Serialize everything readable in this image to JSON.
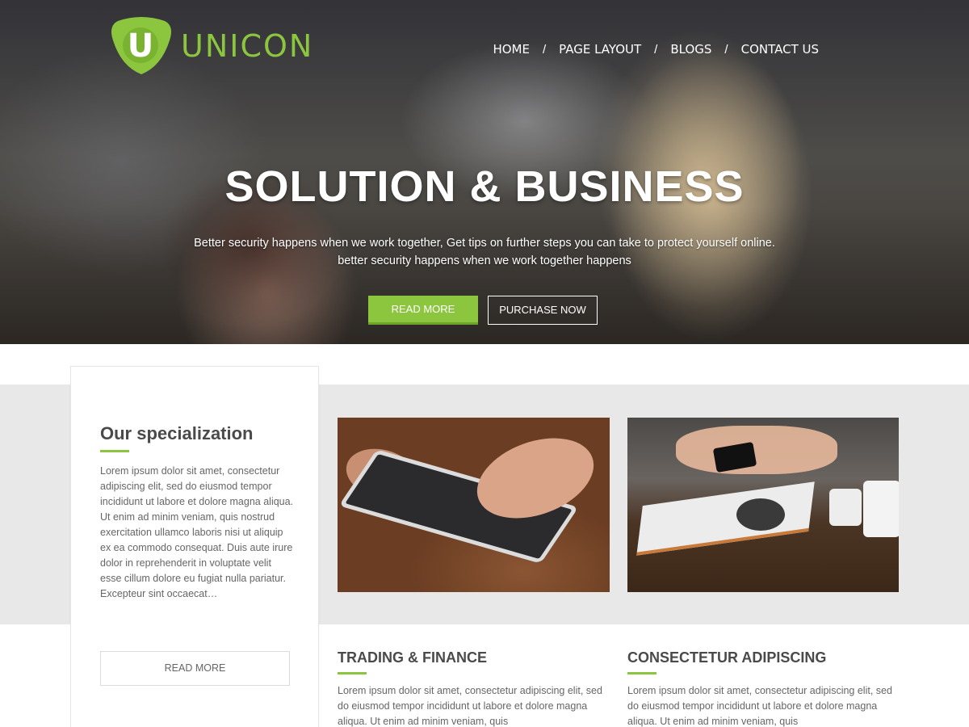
{
  "brand": {
    "name": "UNICON",
    "logo_letter": "U",
    "accent_color": "#8cc63f"
  },
  "nav": {
    "items": [
      "HOME",
      "PAGE LAYOUT",
      "BLOGS",
      "CONTACT US"
    ],
    "separator": "/"
  },
  "hero": {
    "title": "SOLUTION & BUSINESS",
    "subtitle_line1": "Better security happens when we work together, Get tips on further steps you can take to protect yourself online.",
    "subtitle_line2": "better security happens when we work together happens",
    "primary_button": "READ MORE",
    "secondary_button": "PURCHASE NOW"
  },
  "specialization": {
    "title": "Our specialization",
    "text": "Lorem ipsum dolor sit amet, consectetur adipiscing elit, sed do eiusmod tempor incididunt ut labore et dolore magna aliqua. Ut enim ad minim veniam, quis nostrud exercitation ullamco laboris nisi ut aliquip ex ea commodo consequat. Duis aute irure dolor in reprehenderit in voluptate velit esse cillum dolore eu fugiat nulla pariatur. Excepteur sint occaecat…",
    "button": "READ MORE"
  },
  "columns": [
    {
      "title": "TRADING & FINANCE",
      "text": "Lorem ipsum dolor sit amet, consectetur adipiscing elit, sed do eiusmod tempor incididunt ut labore et dolore magna aliqua. Ut enim ad minim veniam, quis"
    },
    {
      "title": "CONSECTETUR ADIPISCING",
      "text": "Lorem ipsum dolor sit amet, consectetur adipiscing elit, sed do eiusmod tempor incididunt ut labore et dolore magna aliqua. Ut enim ad minim veniam, quis"
    }
  ]
}
